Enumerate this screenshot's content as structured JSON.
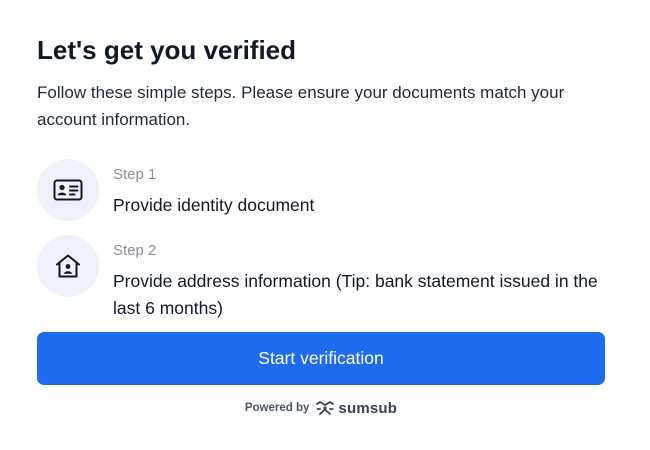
{
  "header": {
    "title": "Let's get you verified",
    "subtitle": "Follow these simple steps. Please ensure your documents match your account information."
  },
  "steps": [
    {
      "label": "Step 1",
      "text": "Provide identity document",
      "icon": "id-card-icon"
    },
    {
      "label": "Step 2",
      "text": "Provide address information (Tip: bank statement issued in the last 6 months)",
      "icon": "home-icon"
    }
  ],
  "actions": {
    "start_label": "Start verification"
  },
  "footer": {
    "powered_by": "Powered by",
    "brand": "sumsub",
    "brand_icon": "sumsub-logo-icon"
  },
  "colors": {
    "primary": "#1f6bf0",
    "icon_bg": "#eef1fa",
    "text": "#111827",
    "muted": "#8a8f98"
  }
}
